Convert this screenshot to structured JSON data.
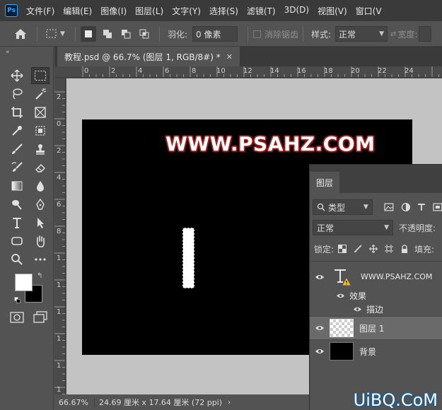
{
  "app": {
    "logo": "Ps"
  },
  "menu": [
    "文件(F)",
    "编辑(E)",
    "图像(I)",
    "图层(L)",
    "文字(Y)",
    "选择(S)",
    "滤镜(T)",
    "3D(D)",
    "视图(V)",
    "窗口(V"
  ],
  "options": {
    "feather_label": "羽化:",
    "feather_value": "0 像素",
    "antialias_label": "消除锯齿",
    "style_label": "样式:",
    "style_value": "正常",
    "width_label": "宽度:"
  },
  "document": {
    "tab_title": "教程.psd @ 66.7% (图层 1, RGB/8#) *",
    "canvas_text": "WWW.PSAHZ.COM",
    "ruler_top": [
      "0",
      "2",
      "4",
      "6",
      "8",
      "10",
      "12",
      "14",
      "16",
      "18",
      "20",
      "22",
      "24"
    ],
    "ruler_left": [
      "2",
      "0",
      "2",
      "4",
      "6",
      "8",
      "1",
      "1",
      "1",
      "1",
      "1",
      "1"
    ]
  },
  "status": {
    "zoom": "66.67%",
    "doc_size": "24.69 厘米 x 17.64 厘米 (72 ppi)"
  },
  "layers_panel": {
    "tab": "图层",
    "filter_value": "类型",
    "blend_value": "正常",
    "opacity_label": "不透明度:",
    "lock_label": "锁定:",
    "fill_label": "填充:",
    "layers": [
      {
        "name": "WWW.PSAHZ.COM",
        "type": "text"
      },
      {
        "name": "效果",
        "type": "effects"
      },
      {
        "name": "描边",
        "type": "effect"
      },
      {
        "name": "图层 1",
        "type": "pixel",
        "selected": true
      },
      {
        "name": "背景",
        "type": "background"
      }
    ]
  },
  "watermark": "UiBQ.CoM",
  "colors": {
    "accent": "#31a8ff",
    "stroke": "#a11818",
    "canvas": "#000000",
    "pasteboard": "#c3c3c3"
  }
}
